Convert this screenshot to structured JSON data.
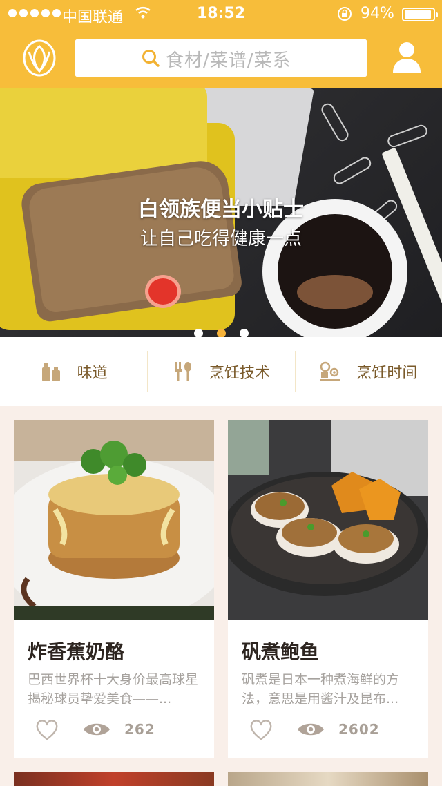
{
  "status_bar": {
    "carrier": "中国联通",
    "time": "18:52",
    "battery": "94%",
    "battery_level": 0.94
  },
  "header": {
    "search_placeholder": "食材/菜谱/菜系",
    "icons": {
      "logo": "tulip-logo-icon",
      "search": "search-icon",
      "user": "user-icon"
    }
  },
  "banner": {
    "title": "白领族便当小贴士",
    "subtitle": "让自己吃得健康一点",
    "active_slide": 2,
    "slides": 3
  },
  "categories": [
    {
      "label": "味道",
      "icon": "seasoning-bottles-icon"
    },
    {
      "label": "烹饪技术",
      "icon": "utensils-icon"
    },
    {
      "label": "烹饪时间",
      "icon": "stove-timer-icon"
    }
  ],
  "recipes": [
    {
      "name": "炸香蕉奶酪",
      "desc": "巴西世界杯十大身价最高球星揭秘球员挚爱美食——...",
      "views": "262"
    },
    {
      "name": "矾煮鲍鱼",
      "desc": "矾煮是日本一种煮海鲜的方法，意思是用酱汁及昆布...",
      "views": "2602"
    }
  ],
  "colors": {
    "accent": "#f7bd3a",
    "category_text": "#7a5a2a",
    "page_bg": "#f9efe9"
  }
}
